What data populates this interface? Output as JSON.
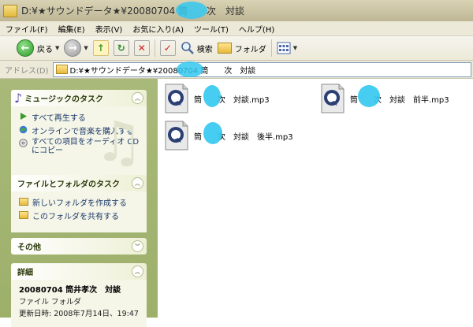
{
  "window": {
    "title": "D:¥★サウンドデータ★¥20080704 筒　　次　対談"
  },
  "menu": {
    "items": [
      "ファイル(F)",
      "編集(E)",
      "表示(V)",
      "お気に入り(A)",
      "ツール(T)",
      "ヘルプ(H)"
    ]
  },
  "toolbar": {
    "back": "戻る",
    "search": "検索",
    "folders": "フォルダ"
  },
  "address": {
    "label": "アドレス(D)",
    "path": "D:¥★サウンドデータ★¥20080704 筒　　次　対談"
  },
  "music_tasks": {
    "title": "ミュージックのタスク",
    "items": [
      "すべて再生する",
      "オンラインで音楽を購入する",
      "すべての項目をオーディオ CD",
      "にコピー"
    ]
  },
  "folder_tasks": {
    "title": "ファイルとフォルダのタスク",
    "items": [
      "新しいフォルダを作成する",
      "このフォルダを共有する"
    ]
  },
  "other_places": {
    "title": "その他"
  },
  "details": {
    "title": "詳細",
    "name": "20080704 筒井孝次　対談",
    "type": "ファイル フォルダ",
    "modified": "更新日時: 2008年7月14日、19:47"
  },
  "files": [
    {
      "name": "筒　　次　対談.mp3"
    },
    {
      "name": "筒　　次　対談　前半.mp3"
    },
    {
      "name": "筒　　次　対談　後半.mp3"
    }
  ],
  "colors": {
    "sidebar": "#a9b97a",
    "panel_bg": "#f5f6e8",
    "redaction": "#33c8f0",
    "link": "#1e3a6a"
  }
}
